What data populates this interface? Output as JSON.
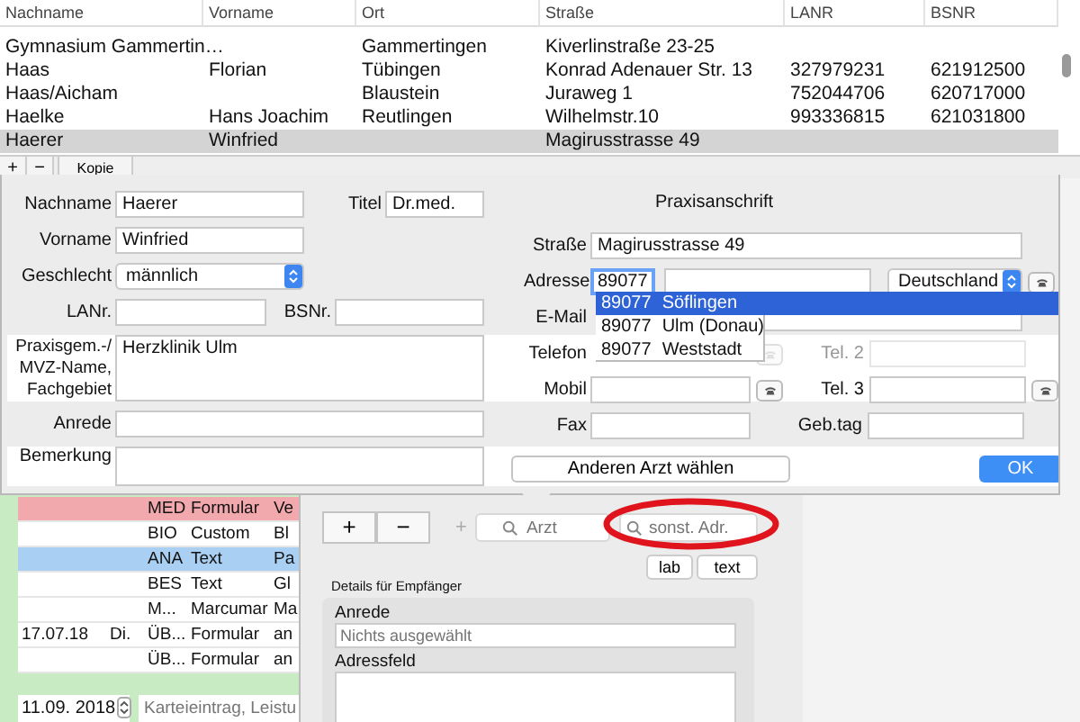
{
  "table": {
    "columns": [
      "Nachname",
      "Vorname",
      "Ort",
      "Straße",
      "LANR",
      "BSNR"
    ],
    "rows": [
      {
        "cells": [
          "Gymnasium Gammertin…",
          null,
          "Gammertingen",
          "Kiverlinstraße 23-25",
          null,
          null
        ],
        "selected": false
      },
      {
        "cells": [
          "Haas",
          "Florian",
          "Tübingen",
          "Konrad Adenauer Str. 13",
          "327979231",
          "621912500"
        ],
        "selected": false
      },
      {
        "cells": [
          "Haas/Aicham",
          null,
          "Blaustein",
          "Juraweg 1",
          "752044706",
          "620717000"
        ],
        "selected": false
      },
      {
        "cells": [
          "Haelke",
          "Hans Joachim",
          "Reutlingen",
          "Wilhelmstr.10",
          "993336815",
          "621031800"
        ],
        "selected": false
      },
      {
        "cells": [
          "Haerer",
          "Winfried",
          null,
          "Magirusstrasse 49",
          null,
          null
        ],
        "selected": true
      }
    ]
  },
  "table_toolbar": {
    "add": "+",
    "remove": "−",
    "copy": "Kopie"
  },
  "doctor_form": {
    "nachname": {
      "label": "Nachname",
      "value": "Haerer"
    },
    "titel": {
      "label": "Titel",
      "value": "Dr.med."
    },
    "vorname": {
      "label": "Vorname",
      "value": "Winfried"
    },
    "geschlecht": {
      "label": "Geschlecht",
      "value": "männlich"
    },
    "lanr": {
      "label": "LANr."
    },
    "bsnr": {
      "label": "BSNr."
    },
    "praxis": {
      "label": "Praxisgem.-/ MVZ-Name, Fachgebiet",
      "value": "Herzklinik Ulm"
    },
    "anrede": {
      "label": "Anrede"
    },
    "bemerkung": {
      "label": "Bemerkung"
    }
  },
  "practice_address": {
    "title": "Praxisanschrift",
    "strasse": {
      "label": "Straße",
      "value": "Magirusstrasse 49"
    },
    "adresse": {
      "label": "Adresse",
      "postcode": "89077",
      "country": "Deutschland"
    },
    "email": {
      "label": "E-Mail"
    },
    "telefon": {
      "label": "Telefon"
    },
    "tel2": {
      "label": "Tel. 2"
    },
    "mobil": {
      "label": "Mobil"
    },
    "tel3": {
      "label": "Tel. 3"
    },
    "fax": {
      "label": "Fax"
    },
    "gebtag": {
      "label": "Geb.tag"
    },
    "suggestions": [
      {
        "postcode": "89077",
        "place": "Söflingen",
        "selected": true
      },
      {
        "postcode": "89077",
        "place": "Ulm (Donau)",
        "selected": false
      },
      {
        "postcode": "89077",
        "place": "Weststadt",
        "selected": false
      }
    ]
  },
  "dialog_buttons": {
    "other_doctor": "Anderen Arzt wählen",
    "ok": "OK"
  },
  "journal": {
    "rows": [
      {
        "code": "MED",
        "type": "Formular",
        "text": "Ve",
        "color": "#f2a9ad"
      },
      {
        "code": "BIO",
        "type": "Custom",
        "text": "Bl"
      },
      {
        "code": "ANA",
        "type": "Text",
        "text": "Pa",
        "color": "#a9cff2"
      },
      {
        "code": "BES",
        "type": "Text",
        "text": "Gl"
      },
      {
        "code": "M...",
        "type": "Marcumar",
        "text": "Ma"
      },
      {
        "date": "17.07.18",
        "day": "Di.",
        "code": "ÜB...",
        "type": "Formular",
        "text": "an"
      },
      {
        "code": "ÜB...",
        "type": "Formular",
        "text": "an"
      }
    ],
    "date": "11.09. 2018",
    "entry_placeholder": "Karteieintrag, Leistu"
  },
  "recipients": {
    "add": "+",
    "remove": "−",
    "small_add": "+",
    "doctor_search": {
      "placeholder": "Arzt"
    },
    "other_search": {
      "placeholder": "sonst. Adr."
    },
    "buttons": [
      "lab",
      "text"
    ],
    "details_title": "Details für Empfänger",
    "anrede": {
      "label": "Anrede",
      "placeholder": "Nichts ausgewählt"
    },
    "adressfeld": {
      "label": "Adressfeld"
    }
  }
}
